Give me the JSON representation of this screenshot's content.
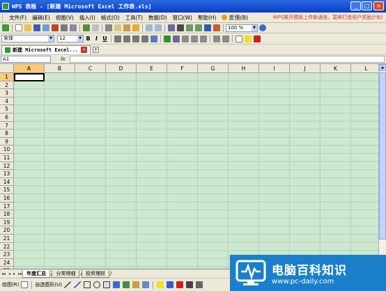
{
  "window": {
    "title": "WPS 表格 - [新建 Microsoft Excel 工作表.xls]",
    "controls": [
      "_",
      "□",
      "×"
    ]
  },
  "menu": {
    "items": [
      "文件(F)",
      "编辑(E)",
      "视图(V)",
      "插入(I)",
      "格式(O)",
      "工具(T)",
      "数据(D)",
      "窗口(W)",
      "帮助(H)"
    ],
    "feedback": "反馈(B)",
    "promo": "WPS推开模板上传新通道，富峰打造用户奖励计划!"
  },
  "toolbar": {
    "zoom": "100 %"
  },
  "format_toolbar": {
    "font_name": "宋体",
    "font_size": "12",
    "bold": "B",
    "italic": "I",
    "underline": "U"
  },
  "doc_tab": {
    "label": "新建 Microsoft Excel...",
    "close": "×",
    "new": "+"
  },
  "formula_bar": {
    "name_box": "A1",
    "fx": "fx",
    "value": ""
  },
  "grid": {
    "columns": [
      "A",
      "B",
      "C",
      "D",
      "E",
      "F",
      "G",
      "H",
      "I",
      "J",
      "K",
      "L"
    ],
    "rows": [
      "1",
      "2",
      "3",
      "4",
      "5",
      "6",
      "7",
      "8",
      "9",
      "10",
      "11",
      "12",
      "13",
      "14",
      "15",
      "16",
      "17",
      "18",
      "19",
      "20",
      "21",
      "22",
      "23",
      "24",
      "25"
    ],
    "selected_cell": "A1",
    "cell_color": "#cce8cf"
  },
  "sheets": {
    "nav": [
      "◂◂",
      "◂",
      "▸",
      "▸▸"
    ],
    "tabs": [
      "年度汇总",
      "分类明细",
      "投资理财"
    ],
    "active": "年度汇总"
  },
  "draw_toolbar": {
    "draw_label": "绘图(R)",
    "autoshape_label": "自选图形(U)"
  },
  "watermark": {
    "main": "电脑百科知识",
    "url": "www.pc-daily.com"
  }
}
